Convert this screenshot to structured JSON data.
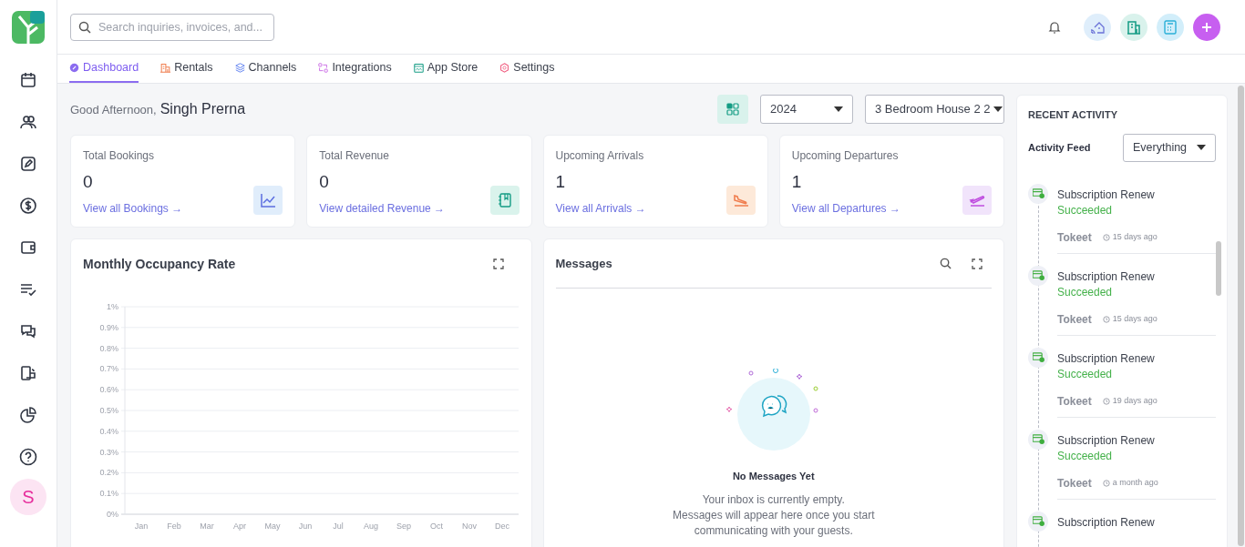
{
  "search": {
    "placeholder": "Search inquiries, invoices, and..."
  },
  "user": {
    "initial": "S"
  },
  "tabs": [
    {
      "label": "Dashboard",
      "selected": true
    },
    {
      "label": "Rentals",
      "selected": false
    },
    {
      "label": "Channels",
      "selected": false
    },
    {
      "label": "Integrations",
      "selected": false
    },
    {
      "label": "App Store",
      "selected": false
    },
    {
      "label": "Settings",
      "selected": false
    }
  ],
  "greeting": {
    "salutation": "Good Afternoon,",
    "name": "Singh Prerna"
  },
  "filters": {
    "year": "2024",
    "rental": "3 Bedroom House 2 2"
  },
  "stats": [
    {
      "title": "Total Bookings",
      "value": "0",
      "link": "View all Bookings →",
      "color": "#e0edfb"
    },
    {
      "title": "Total Revenue",
      "value": "0",
      "link": "View detailed Revenue →",
      "color": "#daf3ec"
    },
    {
      "title": "Upcoming Arrivals",
      "value": "1",
      "link": "View all Arrivals →",
      "color": "#fde9d9"
    },
    {
      "title": "Upcoming Departures",
      "value": "1",
      "link": "View all Departures →",
      "color": "#f1e4fb"
    }
  ],
  "occupancy": {
    "chart_data": {
      "type": "line",
      "grid": true,
      "title": "Monthly Occupancy Rate",
      "categories": [
        "Jan",
        "Feb",
        "Mar",
        "Apr",
        "May",
        "Jun",
        "Jul",
        "Aug",
        "Sep",
        "Oct",
        "Nov",
        "Dec"
      ],
      "ylim": [
        0,
        1
      ],
      "yticks": [
        {
          "value": 0,
          "label": "0%"
        },
        {
          "value": 0.1,
          "label": "0.1%"
        },
        {
          "value": 0.2,
          "label": "0.2%"
        },
        {
          "value": 0.3,
          "label": "0.3%"
        },
        {
          "value": 0.4,
          "label": "0.4%"
        },
        {
          "value": 0.5,
          "label": "0.5%"
        },
        {
          "value": 0.6,
          "label": "0.6%"
        },
        {
          "value": 0.7,
          "label": "0.7%"
        },
        {
          "value": 0.8,
          "label": "0.8%"
        },
        {
          "value": 0.9,
          "label": "0.9%"
        },
        {
          "value": 1,
          "label": "1%"
        }
      ]
    }
  },
  "messages": {
    "title": "Messages",
    "empty_title": "No Messages Yet",
    "empty_text": "Your inbox is currently empty.",
    "empty_hint": "Messages will appear here once you start communicating with your guests."
  },
  "activity": {
    "title": "RECENT ACTIVITY",
    "feed_label": "Activity Feed",
    "feed_filter": "Everything",
    "items": [
      {
        "title": "Subscription Renew",
        "status": "Succeeded",
        "source": "Tokeet",
        "time": "15 days ago"
      },
      {
        "title": "Subscription Renew",
        "status": "Succeeded",
        "source": "Tokeet",
        "time": "15 days ago"
      },
      {
        "title": "Subscription Renew",
        "status": "Succeeded",
        "source": "Tokeet",
        "time": "19 days ago"
      },
      {
        "title": "Subscription Renew",
        "status": "Succeeded",
        "source": "Tokeet",
        "time": "a month ago"
      },
      {
        "title": "Subscription Renew"
      }
    ]
  }
}
